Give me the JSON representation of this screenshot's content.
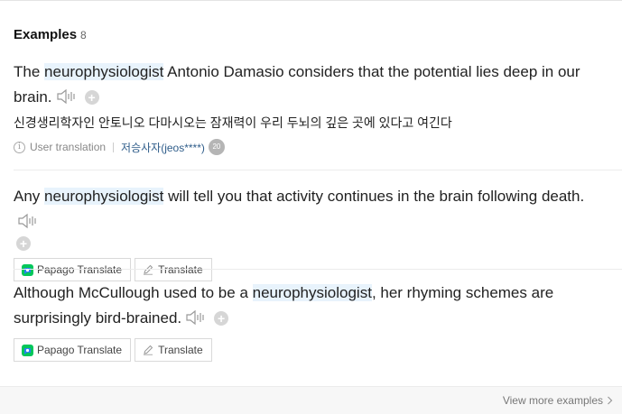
{
  "header": {
    "title": "Examples",
    "count": "8"
  },
  "examples": [
    {
      "before": "The ",
      "term": "neurophysiologist",
      "after": " Antonio Damasio considers that the potential lies deep in our brain.",
      "translation": "신경생리학자인 안토니오 다마시오는 잠재력이 우리 두뇌의 깊은 곳에 있다고 여긴다",
      "source_label": "User translation",
      "user": "저승사자(jeos****)",
      "badge": "20"
    },
    {
      "before": "Any ",
      "term": "neurophysiologist",
      "after": " will tell you that activity continues in the brain following death.",
      "papago_label": "Papago Translate",
      "translate_label": "Translate"
    },
    {
      "before": "Although McCullough used to be a ",
      "term": "neurophysiologist",
      "after": ", her rhyming schemes are surprisingly bird-brained.",
      "papago_label": "Papago Translate",
      "translate_label": "Translate"
    }
  ],
  "footer": {
    "more_label": "View more examples"
  },
  "icons": {
    "speaker": "speaker-icon",
    "add": "plus-icon",
    "info": "info-icon",
    "papago": "papago-icon",
    "pencil": "pencil-icon",
    "chevron": "chevron-right-icon"
  },
  "colors": {
    "highlight": "#e8f3fc",
    "user_link": "#2f5d8a",
    "papago_green": "#03c75a",
    "papago_blue": "#2b7ff1"
  }
}
